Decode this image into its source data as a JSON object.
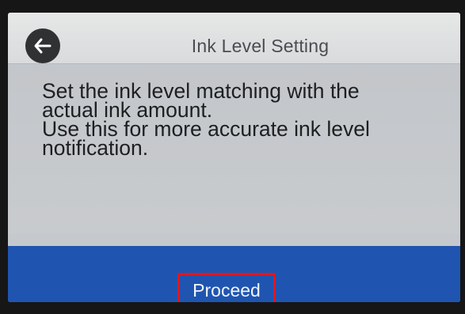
{
  "screen": {
    "header": {
      "title": "Ink Level Setting",
      "back_icon": "back-arrow-icon"
    },
    "message": {
      "lines": [
        "Set the ink level matching with the",
        "actual ink amount.",
        "Use this for more accurate ink level",
        "notification."
      ]
    },
    "footer": {
      "proceed_label": "Proceed"
    }
  },
  "colors": {
    "header_bg": "#dedfe0",
    "content_bg": "#c5c9cd",
    "footer_bg": "#1f55b0",
    "highlight_border": "#e3151d"
  }
}
